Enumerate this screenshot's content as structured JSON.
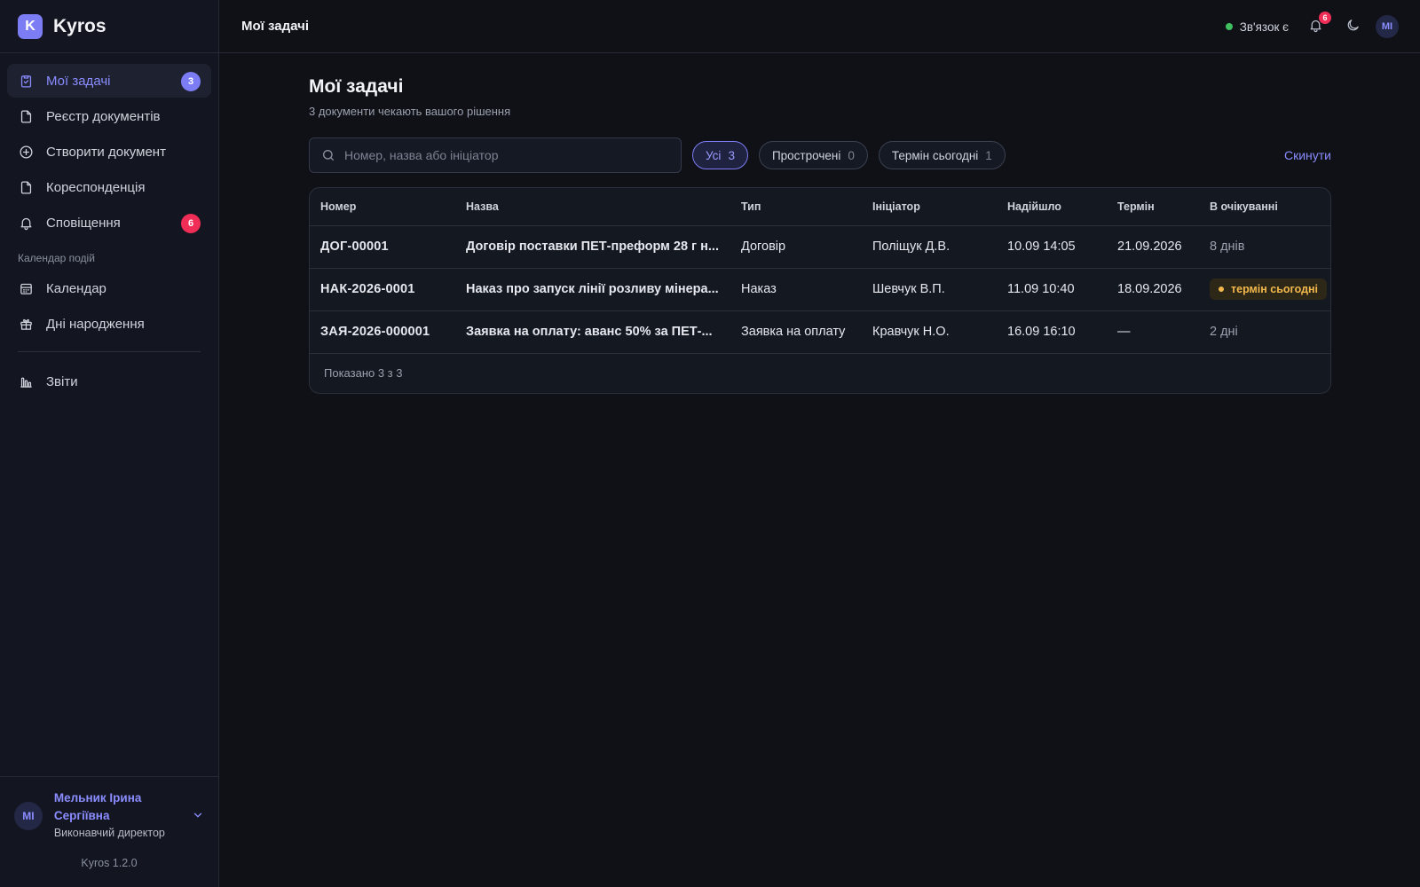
{
  "brand": {
    "logo_letter": "K",
    "name": "Kyros"
  },
  "sidebar": {
    "items": [
      {
        "label": "Мої задачі",
        "badge": "3",
        "icon": "clipboard-check-icon"
      },
      {
        "label": "Реєстр документів",
        "icon": "document-icon"
      },
      {
        "label": "Створити документ",
        "icon": "plus-circle-icon"
      },
      {
        "label": "Кореспонденція",
        "icon": "document-icon"
      },
      {
        "label": "Сповіщення",
        "badge": "6",
        "icon": "bell-icon"
      }
    ],
    "section_label": "Календар подій",
    "calendar_items": [
      {
        "label": "Календар",
        "icon": "calendar-icon"
      },
      {
        "label": "Дні народження",
        "icon": "gift-icon"
      }
    ],
    "reports": {
      "label": "Звіти",
      "icon": "bar-chart-icon"
    }
  },
  "user": {
    "initials": "МІ",
    "name": "Мельник Ірина Сергіївна",
    "role": "Виконавчий директор"
  },
  "version": "Kyros 1.2.0",
  "topbar": {
    "title": "Мої задачі",
    "connection": "Зв'язок є",
    "notifications_count": "6",
    "avatar_initials": "МІ"
  },
  "main": {
    "title": "Мої задачі",
    "subtitle": "3 документи чекають вашого рішення",
    "search_placeholder": "Номер, назва або ініціатор",
    "filters": [
      {
        "label": "Усі",
        "count": "3",
        "active": true
      },
      {
        "label": "Прострочені",
        "count": "0"
      },
      {
        "label": "Термін сьогодні",
        "count": "1"
      }
    ],
    "reset_label": "Скинути"
  },
  "table": {
    "headers": [
      "Номер",
      "Назва",
      "Тип",
      "Ініціатор",
      "Надійшло",
      "Термін",
      "В очікуванні"
    ],
    "rows": [
      {
        "number": "ДОГ-00001",
        "name": "Договір поставки ПЕТ-преформ 28 г н...",
        "type": "Договір",
        "initiator": "Поліщук Д.В.",
        "received": "10.09 14:05",
        "deadline": "21.09.2026",
        "waiting": "8 днів"
      },
      {
        "number": "НАК-2026-0001",
        "name": "Наказ про запуск лінії розливу мінера...",
        "type": "Наказ",
        "initiator": "Шевчук В.П.",
        "received": "11.09 10:40",
        "deadline": "18.09.2026",
        "waiting": "термін сьогодні"
      },
      {
        "number": "ЗАЯ-2026-000001",
        "name": "Заявка на оплату: аванс 50% за ПЕТ-...",
        "type": "Заявка на оплату",
        "initiator": "Кравчук Н.О.",
        "received": "16.09 16:10",
        "deadline": "—",
        "waiting": "2 дні"
      }
    ],
    "footer": "Показано 3 з 3"
  },
  "colors": {
    "accent": "#7c7cf5",
    "danger": "#ef2d56",
    "warning": "#f2b84b",
    "online": "#3fbf5f"
  }
}
